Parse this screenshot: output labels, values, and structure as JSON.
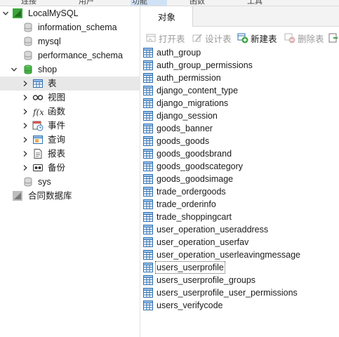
{
  "menu": [
    "连接",
    "用户",
    "功能",
    "函数",
    "工具"
  ],
  "tree": [
    {
      "id": "conn",
      "label": "LocalMySQL",
      "arrow": "open",
      "icon": "mysql-connection-icon",
      "level": 0
    },
    {
      "id": "db-information-schema",
      "label": "information_schema",
      "arrow": "",
      "icon": "database-icon",
      "level": 1
    },
    {
      "id": "db-mysql",
      "label": "mysql",
      "arrow": "",
      "icon": "database-icon",
      "level": 1
    },
    {
      "id": "db-performance-schema",
      "label": "performance_schema",
      "arrow": "",
      "icon": "database-icon",
      "level": 1
    },
    {
      "id": "db-shop",
      "label": "shop",
      "arrow": "open",
      "icon": "database-open-icon",
      "level": 1
    },
    {
      "id": "shop-tables",
      "label": "表",
      "arrow": "closed",
      "icon": "tables-icon",
      "level": 2,
      "selected": true
    },
    {
      "id": "shop-views",
      "label": "视图",
      "arrow": "closed",
      "icon": "views-icon",
      "level": 2
    },
    {
      "id": "shop-functions",
      "label": "函数",
      "arrow": "closed",
      "icon": "function-icon",
      "level": 2
    },
    {
      "id": "shop-events",
      "label": "事件",
      "arrow": "closed",
      "icon": "event-icon",
      "level": 2
    },
    {
      "id": "shop-queries",
      "label": "查询",
      "arrow": "closed",
      "icon": "query-icon",
      "level": 2
    },
    {
      "id": "shop-reports",
      "label": "报表",
      "arrow": "closed",
      "icon": "report-icon",
      "level": 2
    },
    {
      "id": "shop-backups",
      "label": "备份",
      "arrow": "closed",
      "icon": "backup-icon",
      "level": 2
    },
    {
      "id": "db-sys",
      "label": "sys",
      "arrow": "",
      "icon": "database-icon",
      "level": 1
    },
    {
      "id": "merged-db",
      "label": "合同数据库",
      "arrow": "",
      "icon": "merged-database-icon",
      "level": 0
    }
  ],
  "tabs": {
    "objects": "对象"
  },
  "toolbar": {
    "open_table": "打开表",
    "design_table": "设计表",
    "new_table": "新建表",
    "delete_table": "删除表"
  },
  "tables": [
    "auth_group",
    "auth_group_permissions",
    "auth_permission",
    "django_content_type",
    "django_migrations",
    "django_session",
    "goods_banner",
    "goods_goods",
    "goods_goodsbrand",
    "goods_goodscategory",
    "goods_goodsimage",
    "trade_ordergoods",
    "trade_orderinfo",
    "trade_shoppingcart",
    "user_operation_useraddress",
    "user_operation_userfav",
    "user_operation_userleavingmessage",
    "users_userprofile",
    "users_userprofile_groups",
    "users_userprofile_user_permissions",
    "users_verifycode"
  ],
  "focused_table": "users_userprofile",
  "colors": {
    "accent_green": "#3aa63a",
    "selection": "#e8e8e8",
    "table_icon": "#2f6fb0"
  }
}
